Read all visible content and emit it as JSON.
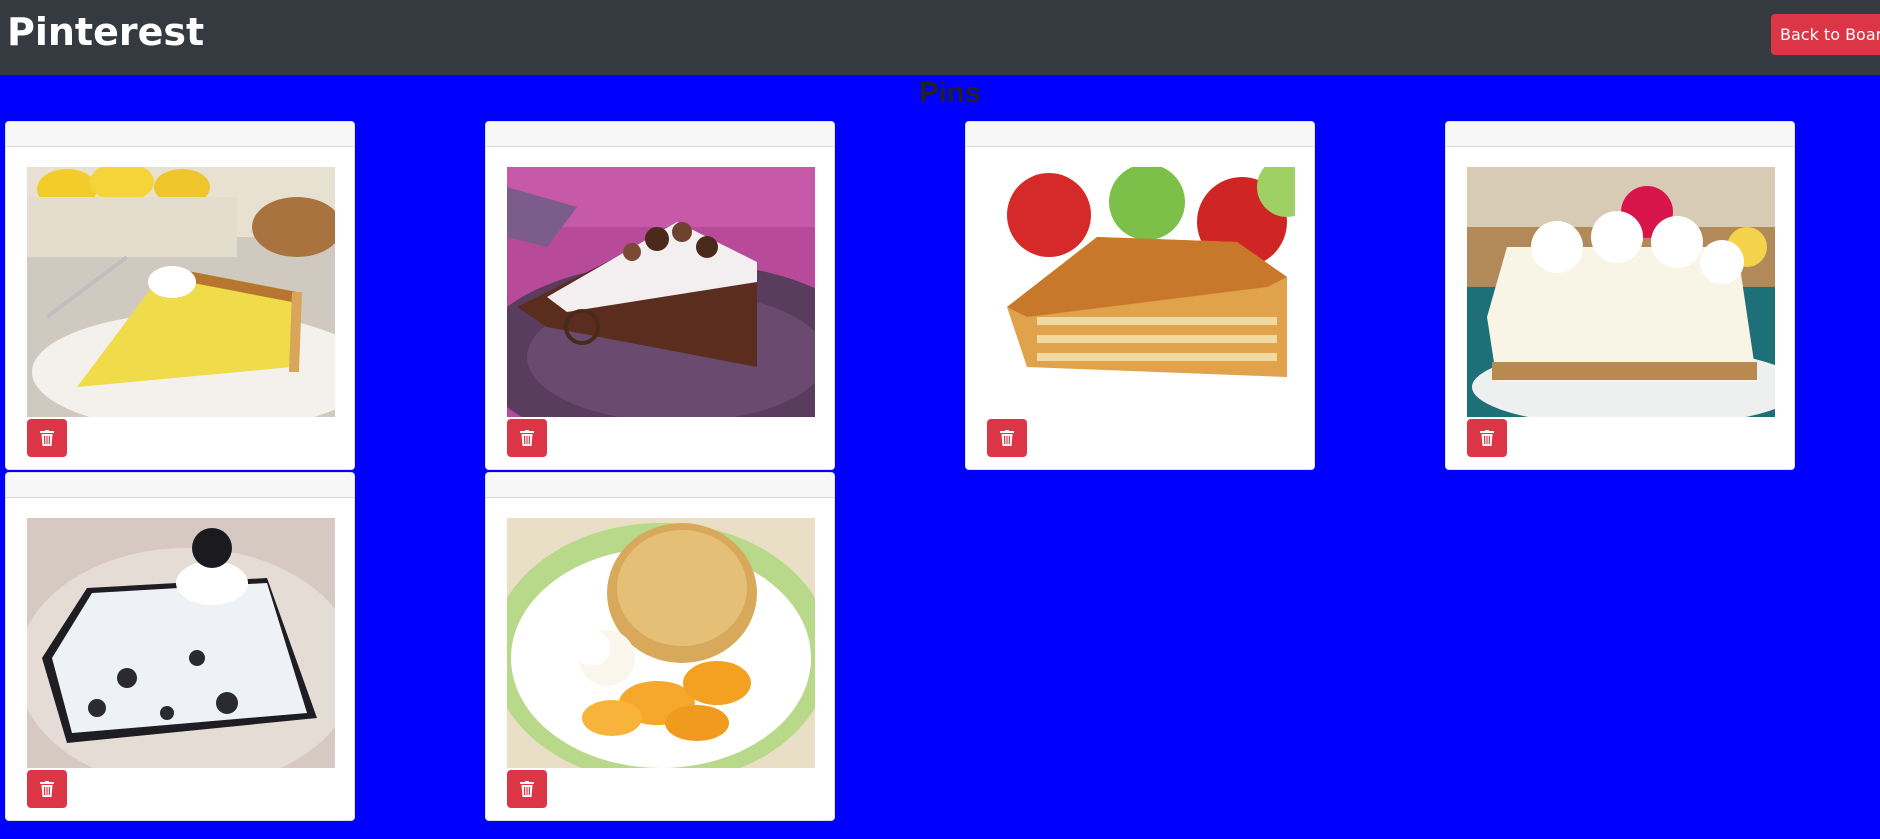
{
  "navbar": {
    "brand": "Pinterest",
    "back_button_label": "Back to Boards"
  },
  "page": {
    "heading": "Pins"
  },
  "colors": {
    "background": "#0000ff",
    "navbar": "#343a40",
    "danger": "#dc3545"
  },
  "pins": [
    {
      "subject": "lemon chess pie slice",
      "delete_icon": "trash-icon"
    },
    {
      "subject": "chocolate cream pie slice",
      "delete_icon": "trash-icon"
    },
    {
      "subject": "apple pie slice",
      "delete_icon": "trash-icon"
    },
    {
      "subject": "banana cream pie slice",
      "delete_icon": "trash-icon"
    },
    {
      "subject": "oreo cream pie slice",
      "delete_icon": "trash-icon"
    },
    {
      "subject": "peach cobbler",
      "delete_icon": "trash-icon"
    }
  ]
}
